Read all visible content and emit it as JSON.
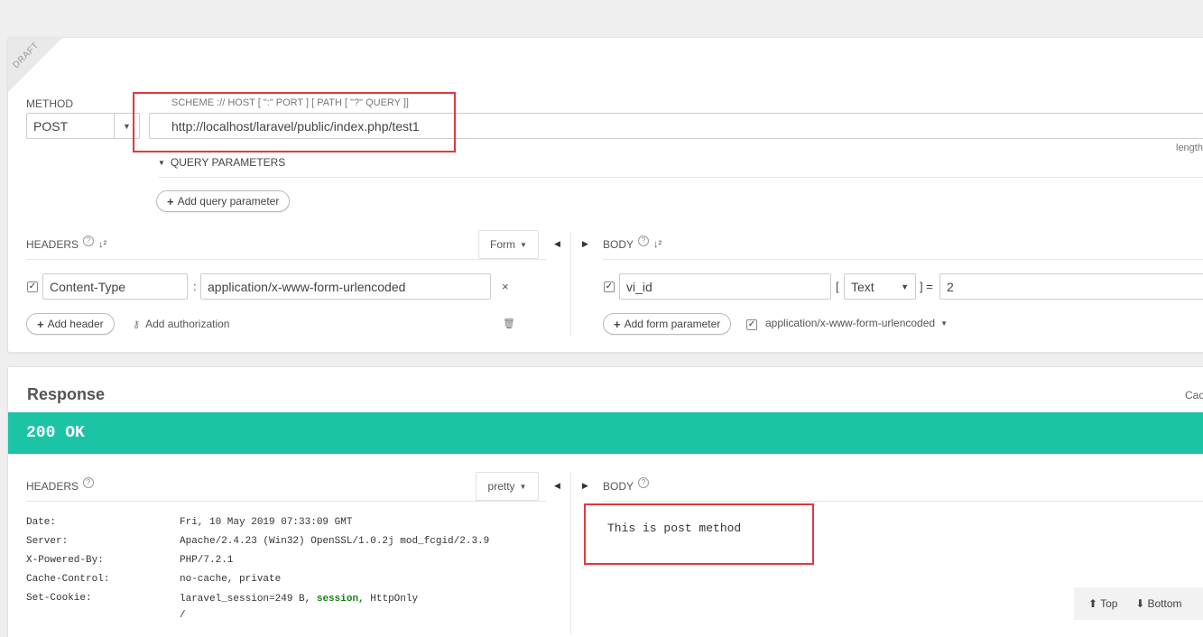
{
  "request": {
    "draft_label": "DRAFT",
    "method": {
      "label": "METHOD",
      "value": "POST"
    },
    "url": {
      "label": "SCHEME :// HOST [ \":\" PORT ] [ PATH [ \"?\" QUERY ]]",
      "value": "http://localhost/laravel/public/index.php/test1",
      "length_label": "length"
    },
    "query_params": {
      "toggle_label": "QUERY PARAMETERS",
      "add_label": "Add query parameter"
    },
    "headers": {
      "title": "HEADERS",
      "form_tab": "Form",
      "row": {
        "name": "Content-Type",
        "separator": ":",
        "value": "application/x-www-form-urlencoded"
      },
      "add_label": "Add header",
      "auth_label": "Add authorization"
    },
    "body": {
      "title": "BODY",
      "row": {
        "name": "vi_id",
        "open_bracket": "[",
        "type": "Text",
        "close_bracket": "] =",
        "value": "2"
      },
      "add_label": "Add form parameter",
      "content_type": "application/x-www-form-urlencoded"
    }
  },
  "response": {
    "title": "Response",
    "cache_label": "Cac",
    "status": "200 OK",
    "headers": {
      "title": "HEADERS",
      "mode": "pretty",
      "items": [
        {
          "key": "Date:",
          "value": "Fri, 10 May 2019 07:33:09 GMT"
        },
        {
          "key": "Server:",
          "value": "Apache/2.4.23 (Win32) OpenSSL/1.0.2j mod_fcgid/2.3.9"
        },
        {
          "key": "X-Powered-By:",
          "value": "PHP/7.2.1"
        },
        {
          "key": "Cache-Control:",
          "value": "no-cache, private"
        }
      ],
      "cookie": {
        "key": "Set-Cookie:",
        "prefix": "laravel_session=249 B,",
        "keyword": "session,",
        "suffix": "HttpOnly",
        "line2": "/"
      }
    },
    "body": {
      "title": "BODY",
      "content": "This is post method"
    },
    "nav": {
      "top": "Top",
      "bottom": "Bottom"
    }
  }
}
